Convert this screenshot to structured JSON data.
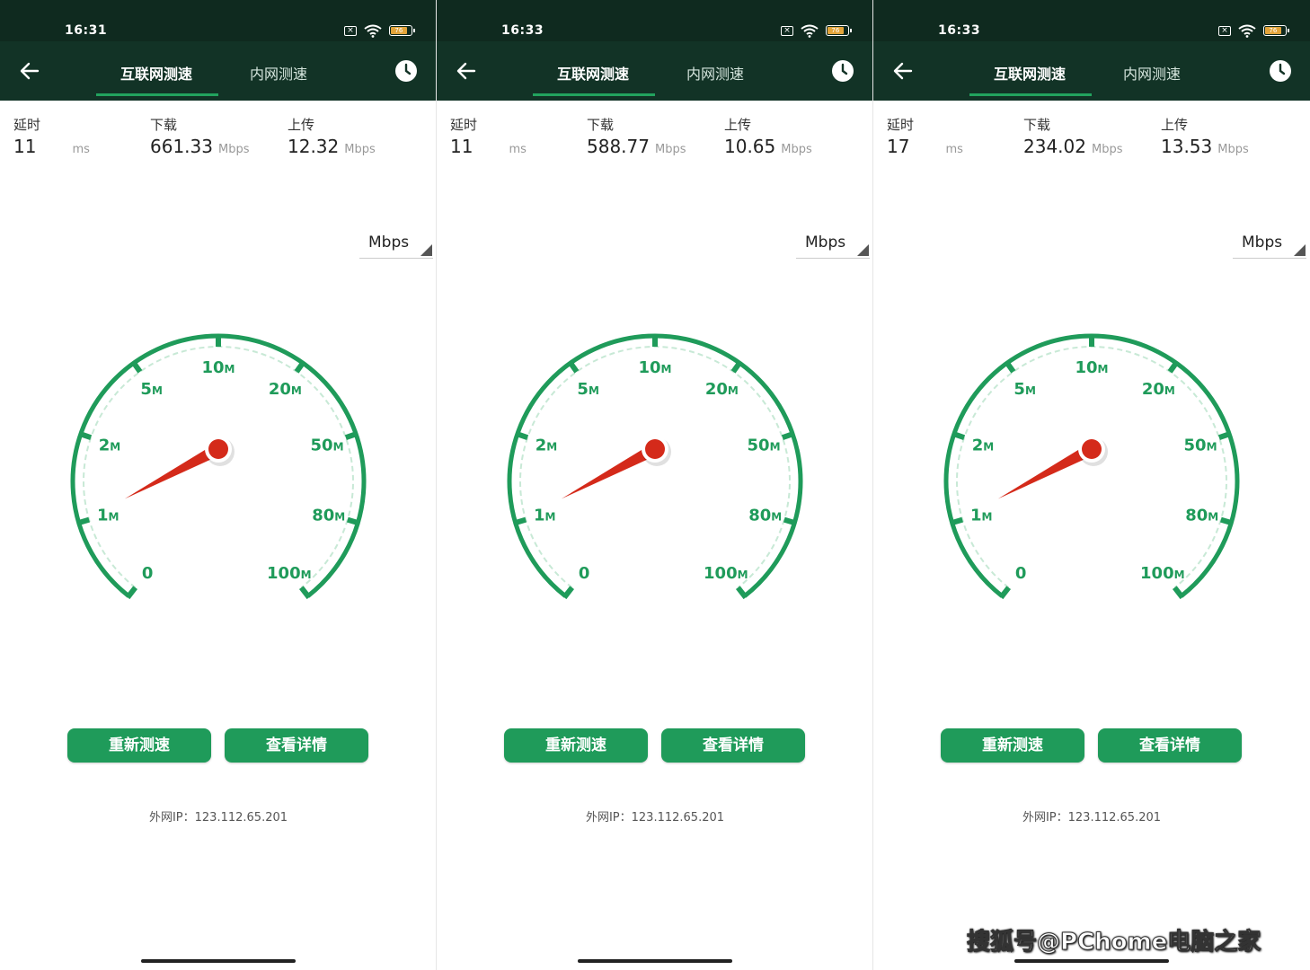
{
  "colors": {
    "accent": "#1f9b5a",
    "gauge_green": "#1f9b5a",
    "needle": "#d42a1a",
    "topbar": "#123326"
  },
  "panels": [
    {
      "time": "16:31",
      "battery": "76",
      "tabs": [
        "互联网测速",
        "内网测速"
      ],
      "stats": {
        "latency_label": "延时",
        "latency_value": "11",
        "latency_unit": "ms",
        "download_label": "下载",
        "download_value": "661.33",
        "download_unit": "Mbps",
        "upload_label": "上传",
        "upload_value": "12.32",
        "upload_unit": "Mbps"
      },
      "unit_select": "Mbps",
      "gauge_labels": [
        "0",
        "1M",
        "2M",
        "5M",
        "10M",
        "20M",
        "50M",
        "80M",
        "100M"
      ],
      "buttons": [
        "重新测速",
        "查看详情"
      ],
      "ip": "外网IP：123.112.65.201"
    },
    {
      "time": "16:33",
      "battery": "76",
      "tabs": [
        "互联网测速",
        "内网测速"
      ],
      "stats": {
        "latency_label": "延时",
        "latency_value": "11",
        "latency_unit": "ms",
        "download_label": "下载",
        "download_value": "588.77",
        "download_unit": "Mbps",
        "upload_label": "上传",
        "upload_value": "10.65",
        "upload_unit": "Mbps"
      },
      "unit_select": "Mbps",
      "gauge_labels": [
        "0",
        "1M",
        "2M",
        "5M",
        "10M",
        "20M",
        "50M",
        "80M",
        "100M"
      ],
      "buttons": [
        "重新测速",
        "查看详情"
      ],
      "ip": "外网IP：123.112.65.201"
    },
    {
      "time": "16:33",
      "battery": "76",
      "tabs": [
        "互联网测速",
        "内网测速"
      ],
      "stats": {
        "latency_label": "延时",
        "latency_value": "17",
        "latency_unit": "ms",
        "download_label": "下载",
        "download_value": "234.02",
        "download_unit": "Mbps",
        "upload_label": "上传",
        "upload_value": "13.53",
        "upload_unit": "Mbps"
      },
      "unit_select": "Mbps",
      "gauge_labels": [
        "0",
        "1M",
        "2M",
        "5M",
        "10M",
        "20M",
        "50M",
        "80M",
        "100M"
      ],
      "buttons": [
        "重新测速",
        "查看详情"
      ],
      "ip": "外网IP：123.112.65.201"
    }
  ],
  "watermark": "搜狐号@PChome电脑之家"
}
